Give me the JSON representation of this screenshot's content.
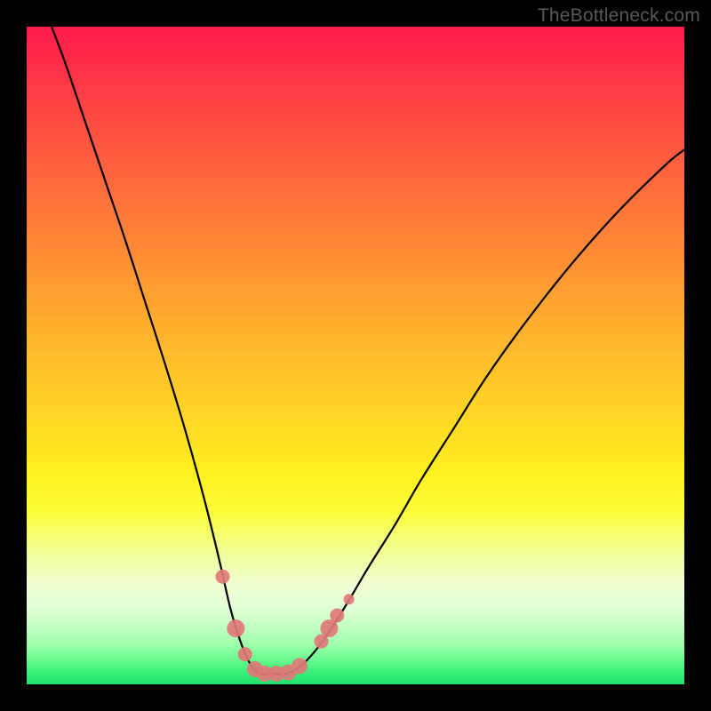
{
  "watermark": "TheBottleneck.com",
  "chart_data": {
    "type": "line",
    "title": "",
    "xlabel": "",
    "ylabel": "",
    "xlim": [
      0,
      1
    ],
    "ylim": [
      0,
      1
    ],
    "series": [
      {
        "name": "bottleneck-curve",
        "x": [
          0.038,
          0.06,
          0.09,
          0.12,
          0.15,
          0.18,
          0.21,
          0.24,
          0.27,
          0.293,
          0.31,
          0.325,
          0.34,
          0.355,
          0.372,
          0.395,
          0.42,
          0.45,
          0.485,
          0.52,
          0.56,
          0.6,
          0.65,
          0.7,
          0.76,
          0.83,
          0.9,
          0.97,
          1.0
        ],
        "y": [
          1.0,
          0.94,
          0.85,
          0.76,
          0.67,
          0.575,
          0.48,
          0.38,
          0.27,
          0.175,
          0.1,
          0.05,
          0.015,
          0.0,
          0.0,
          0.0,
          0.015,
          0.05,
          0.105,
          0.165,
          0.23,
          0.3,
          0.38,
          0.46,
          0.545,
          0.635,
          0.715,
          0.785,
          0.81
        ],
        "color": "#000000"
      }
    ],
    "markers": [
      {
        "name": "marker",
        "x": 0.298,
        "y": 0.15,
        "r": 8,
        "color": "#e07878"
      },
      {
        "name": "marker",
        "x": 0.318,
        "y": 0.07,
        "r": 10,
        "color": "#e07878"
      },
      {
        "name": "marker",
        "x": 0.332,
        "y": 0.03,
        "r": 8,
        "color": "#e07878"
      },
      {
        "name": "marker",
        "x": 0.347,
        "y": 0.007,
        "r": 9,
        "color": "#e07878"
      },
      {
        "name": "marker",
        "x": 0.362,
        "y": 0.0,
        "r": 9,
        "color": "#e07878"
      },
      {
        "name": "marker",
        "x": 0.38,
        "y": 0.0,
        "r": 9,
        "color": "#e07878"
      },
      {
        "name": "marker",
        "x": 0.398,
        "y": 0.002,
        "r": 9,
        "color": "#e07878"
      },
      {
        "name": "marker",
        "x": 0.415,
        "y": 0.012,
        "r": 9,
        "color": "#e07878"
      },
      {
        "name": "marker",
        "x": 0.448,
        "y": 0.05,
        "r": 8,
        "color": "#e07878"
      },
      {
        "name": "marker",
        "x": 0.46,
        "y": 0.07,
        "r": 10,
        "color": "#e07878"
      },
      {
        "name": "marker",
        "x": 0.472,
        "y": 0.09,
        "r": 8,
        "color": "#e07878"
      },
      {
        "name": "marker",
        "x": 0.49,
        "y": 0.115,
        "r": 6,
        "color": "#e07878"
      }
    ],
    "gradient_stops": [
      {
        "pos": 0.0,
        "color": "#ff1a4c"
      },
      {
        "pos": 0.35,
        "color": "#ff8a35"
      },
      {
        "pos": 0.68,
        "color": "#fff020"
      },
      {
        "pos": 0.88,
        "color": "#e6ffd8"
      },
      {
        "pos": 1.0,
        "color": "#1fe26b"
      }
    ]
  }
}
